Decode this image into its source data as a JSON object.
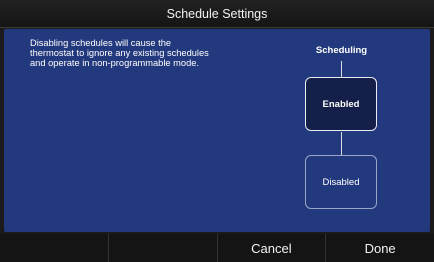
{
  "title": "Schedule Settings",
  "description": "Disabling schedules will cause the thermostat to ignore any existing schedules and operate in non-programmable mode.",
  "scheduling": {
    "label": "Scheduling",
    "selected": "Enabled",
    "options": [
      {
        "label": "Enabled"
      },
      {
        "label": "Disabled"
      }
    ]
  },
  "footer": {
    "cancel_label": "Cancel",
    "done_label": "Done"
  }
}
